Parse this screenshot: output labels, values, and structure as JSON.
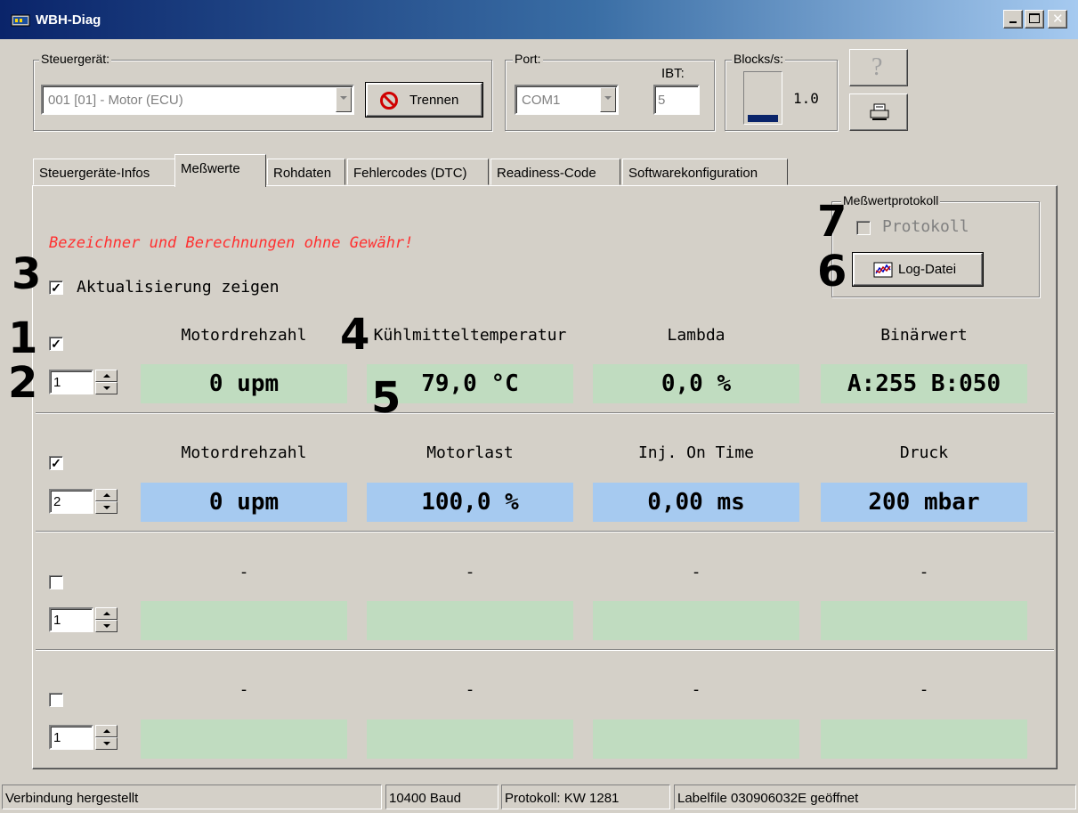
{
  "window": {
    "title": "WBH-Diag"
  },
  "ecu_group": {
    "label": "Steuergerät:",
    "selected": "001 [01] - Motor (ECU)",
    "disconnect_label": "Trennen"
  },
  "port_group": {
    "label": "Port:",
    "port_value": "COM1",
    "ibt_label": "IBT:",
    "ibt_value": "5"
  },
  "blocks_group": {
    "label": "Blocks/s:",
    "value": "1.0",
    "level": 0.15
  },
  "toolbar": {
    "help_icon": "question-icon",
    "print_icon": "printer-icon"
  },
  "tabs": [
    {
      "label": "Steuergeräte-Infos",
      "active": false
    },
    {
      "label": "Meßwerte",
      "active": true
    },
    {
      "label": "Rohdaten",
      "active": false
    },
    {
      "label": "Fehlercodes (DTC)",
      "active": false
    },
    {
      "label": "Readiness-Code",
      "active": false
    },
    {
      "label": "Softwarekonfiguration",
      "active": false
    }
  ],
  "protocol_group": {
    "label": "Meßwertprotokoll",
    "checkbox_label": "Protokoll",
    "log_button_label": "Log-Datei"
  },
  "disclaimer": "Bezeichner und Berechnungen ohne Gewähr!",
  "show_update": {
    "label": "Aktualisierung zeigen",
    "checked": true
  },
  "rows": [
    {
      "checked": true,
      "group": "1",
      "labels": [
        "Motordrehzahl",
        "Kühlmitteltemperatur",
        "Lambda",
        "Binärwert"
      ],
      "values": [
        "0 upm",
        "79,0 °C",
        "0,0 %",
        "A:255 B:050"
      ],
      "color": "green"
    },
    {
      "checked": true,
      "group": "2",
      "labels": [
        "Motordrehzahl",
        "Motorlast",
        "Inj. On Time",
        "Druck"
      ],
      "values": [
        "0 upm",
        "100,0 %",
        "0,00 ms",
        "200 mbar"
      ],
      "color": "blue"
    },
    {
      "checked": false,
      "group": "1",
      "labels": [
        "-",
        "-",
        "-",
        "-"
      ],
      "values": [
        "",
        "",
        "",
        ""
      ],
      "color": "green"
    },
    {
      "checked": false,
      "group": "1",
      "labels": [
        "-",
        "-",
        "-",
        "-"
      ],
      "values": [
        "",
        "",
        "",
        ""
      ],
      "color": "green"
    }
  ],
  "annotations": [
    "1",
    "2",
    "3",
    "4",
    "5",
    "6",
    "7"
  ],
  "status_bar": {
    "connection": "Verbindung hergestellt",
    "baud": "10400 Baud",
    "protocol": "Protokoll: KW 1281",
    "labelfile": "Labelfile 030906032E geöffnet"
  },
  "colors": {
    "title_gradient_start": "#0a246a",
    "title_gradient_end": "#a6caf0",
    "value_green": "#c0dcc0",
    "value_blue": "#a6caf0",
    "disclaimer_red": "#ff3030"
  }
}
